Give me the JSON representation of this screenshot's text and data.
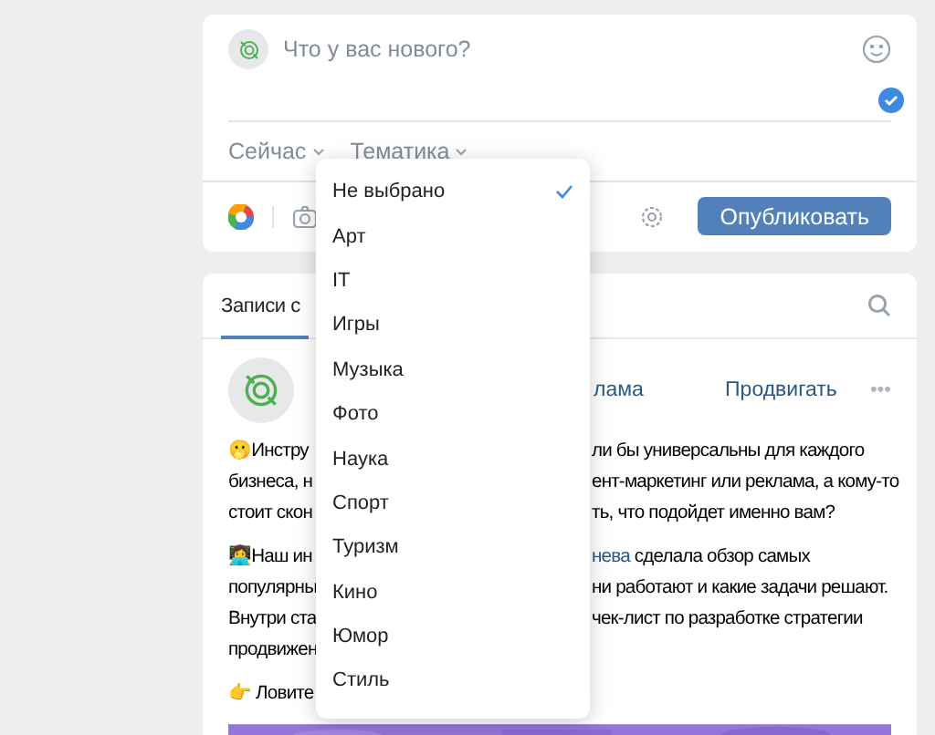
{
  "composer": {
    "placeholder": "Что у вас нового?",
    "options": [
      {
        "label": "Сейчас"
      },
      {
        "label": "Тематика"
      }
    ],
    "publish_button": "Опубликовать"
  },
  "topic_menu": {
    "items": [
      {
        "label": "Не выбрано",
        "selected": true
      },
      {
        "label": "Арт",
        "selected": false
      },
      {
        "label": "IT",
        "selected": false
      },
      {
        "label": "Игры",
        "selected": false
      },
      {
        "label": "Музыка",
        "selected": false
      },
      {
        "label": "Фото",
        "selected": false
      },
      {
        "label": "Наука",
        "selected": false
      },
      {
        "label": "Спорт",
        "selected": false
      },
      {
        "label": "Туризм",
        "selected": false
      },
      {
        "label": "Кино",
        "selected": false
      },
      {
        "label": "Юмор",
        "selected": false
      },
      {
        "label": "Стиль",
        "selected": false
      }
    ]
  },
  "feed": {
    "tab": "Записи с",
    "post": {
      "author": "лама",
      "promote": "Продвигать",
      "more": "•••",
      "paragraphs": [
        [
          {
            "left": "🫢Инстру",
            "right": "ли бы универсальны для каждого"
          },
          {
            "left": "бизнеса, н",
            "right": "ент-маркетинг или реклама, а кому-то"
          },
          {
            "left": "стоит скон",
            "right": "ть, что подойдет именно вам?"
          }
        ],
        [
          {
            "left": "👩‍💻Наш ин",
            "right": "**нева** сделала обзор самых"
          },
          {
            "left": "популярны",
            "right": "ни работают и какие задачи решают."
          },
          {
            "left": "Внутри ста",
            "right": "чек-лист по разработке стратегии"
          },
          {
            "left": "продвижен"
          }
        ],
        [
          {
            "left": "👉 Ловите"
          }
        ]
      ],
      "image": {
        "kind": "picture"
      }
    }
  }
}
